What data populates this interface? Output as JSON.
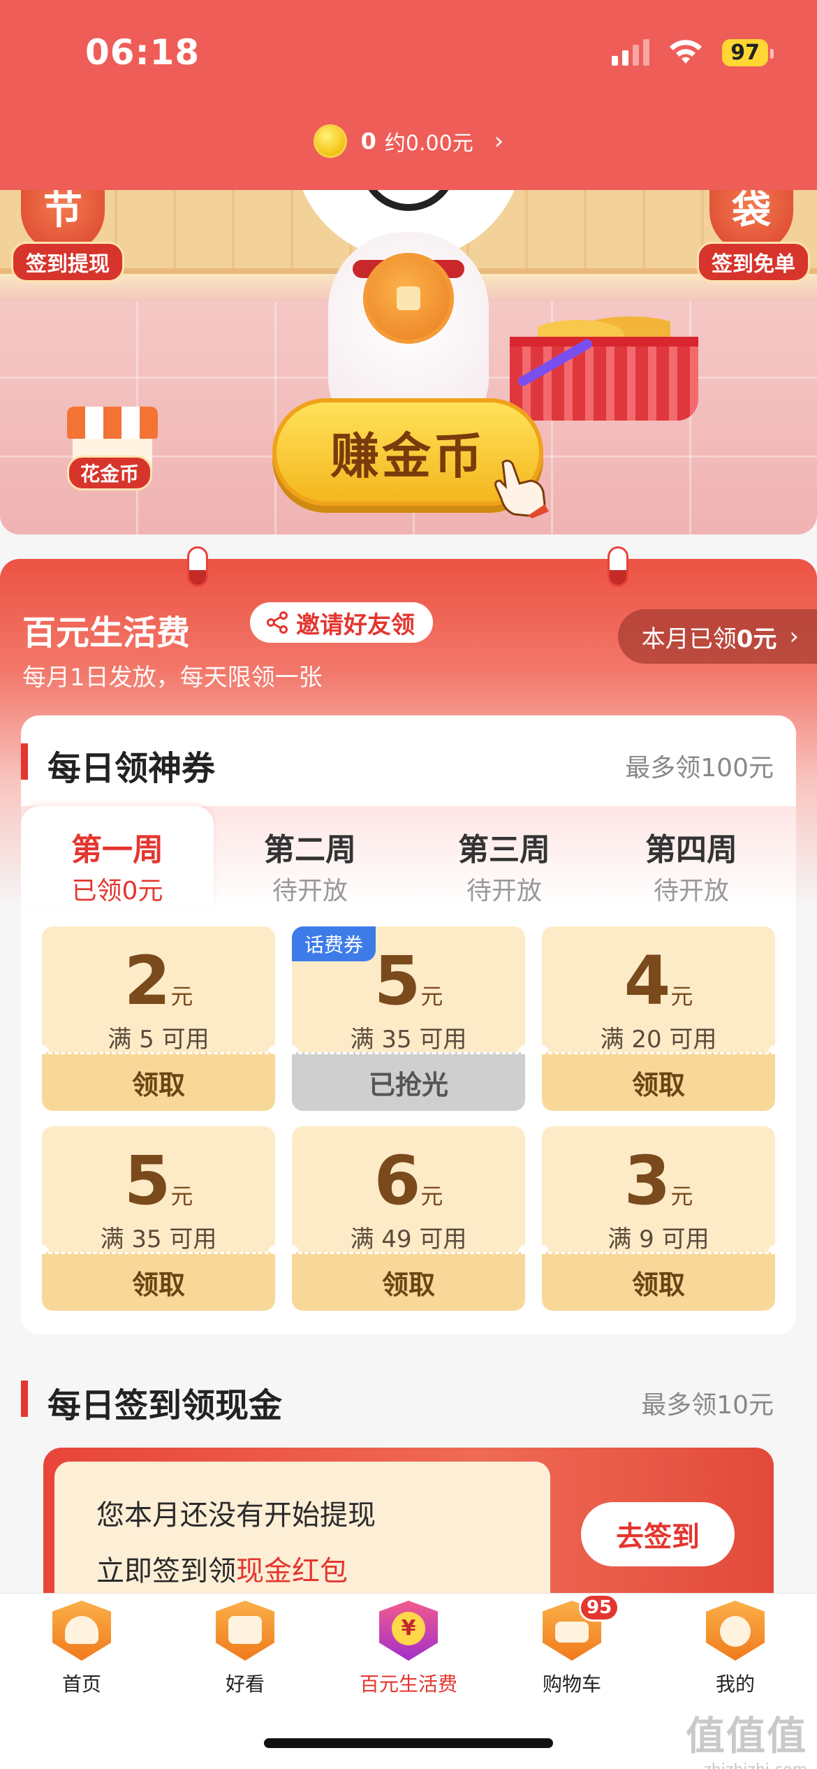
{
  "status_bar": {
    "time": "06:18",
    "battery": "97"
  },
  "header": {
    "coin_count": "0",
    "coin_value": "约0.00元",
    "chevron": "›"
  },
  "hero": {
    "left_badge_char": "节",
    "left_badge_label": "签到提现",
    "right_badge_char": "袋",
    "right_badge_label": "签到免单",
    "earn_button": "赚金币",
    "spend_label": "花金币"
  },
  "panel": {
    "title": "百元生活费",
    "invite_label": "邀请好友领",
    "subtitle": "每月1日发放，每天限领一张",
    "month_claimed_prefix": "本月已领",
    "month_claimed_amount": "0元",
    "month_claimed_chevron": "›"
  },
  "coupon_card": {
    "title": "每日领神券",
    "limit": "最多领100元",
    "weeks": [
      {
        "name": "第一周",
        "status": "已领0元"
      },
      {
        "name": "第二周",
        "status": "待开放"
      },
      {
        "name": "第三周",
        "status": "待开放"
      },
      {
        "name": "第四周",
        "status": "待开放"
      }
    ],
    "coupons": [
      {
        "value": "2",
        "unit": "元",
        "condition": "满 5 可用",
        "action": "领取",
        "tag": ""
      },
      {
        "value": "5",
        "unit": "元",
        "condition": "满 35 可用",
        "action": "已抢光",
        "tag": "话费券"
      },
      {
        "value": "4",
        "unit": "元",
        "condition": "满 20 可用",
        "action": "领取",
        "tag": ""
      },
      {
        "value": "5",
        "unit": "元",
        "condition": "满 35 可用",
        "action": "领取",
        "tag": ""
      },
      {
        "value": "6",
        "unit": "元",
        "condition": "满 49 可用",
        "action": "领取",
        "tag": ""
      },
      {
        "value": "3",
        "unit": "元",
        "condition": "满 9 可用",
        "action": "领取",
        "tag": ""
      }
    ]
  },
  "signin_section": {
    "title": "每日签到领现金",
    "limit": "最多领10元",
    "line1": "您本月还没有开始提现",
    "line2_prefix": "立即签到领",
    "line2_highlight": "现金红包",
    "button": "去签到"
  },
  "tabbar": {
    "tabs": [
      {
        "label": "首页",
        "icon": "home-icon"
      },
      {
        "label": "好看",
        "icon": "video-icon"
      },
      {
        "label": "百元生活费",
        "icon": "yen-icon",
        "active": true
      },
      {
        "label": "购物车",
        "icon": "cart-icon",
        "badge": "95"
      },
      {
        "label": "我的",
        "icon": "profile-icon"
      }
    ]
  },
  "watermark": {
    "big": "值值值",
    "small": "zhizhizhi.com"
  },
  "colors": {
    "primary_red": "#e3362f",
    "header_red": "#ef5d58",
    "coupon_bg": "#fdebc8",
    "coupon_button": "#f8d898",
    "soldout_gray": "#cfcfcf",
    "tag_blue": "#3d7be8"
  }
}
